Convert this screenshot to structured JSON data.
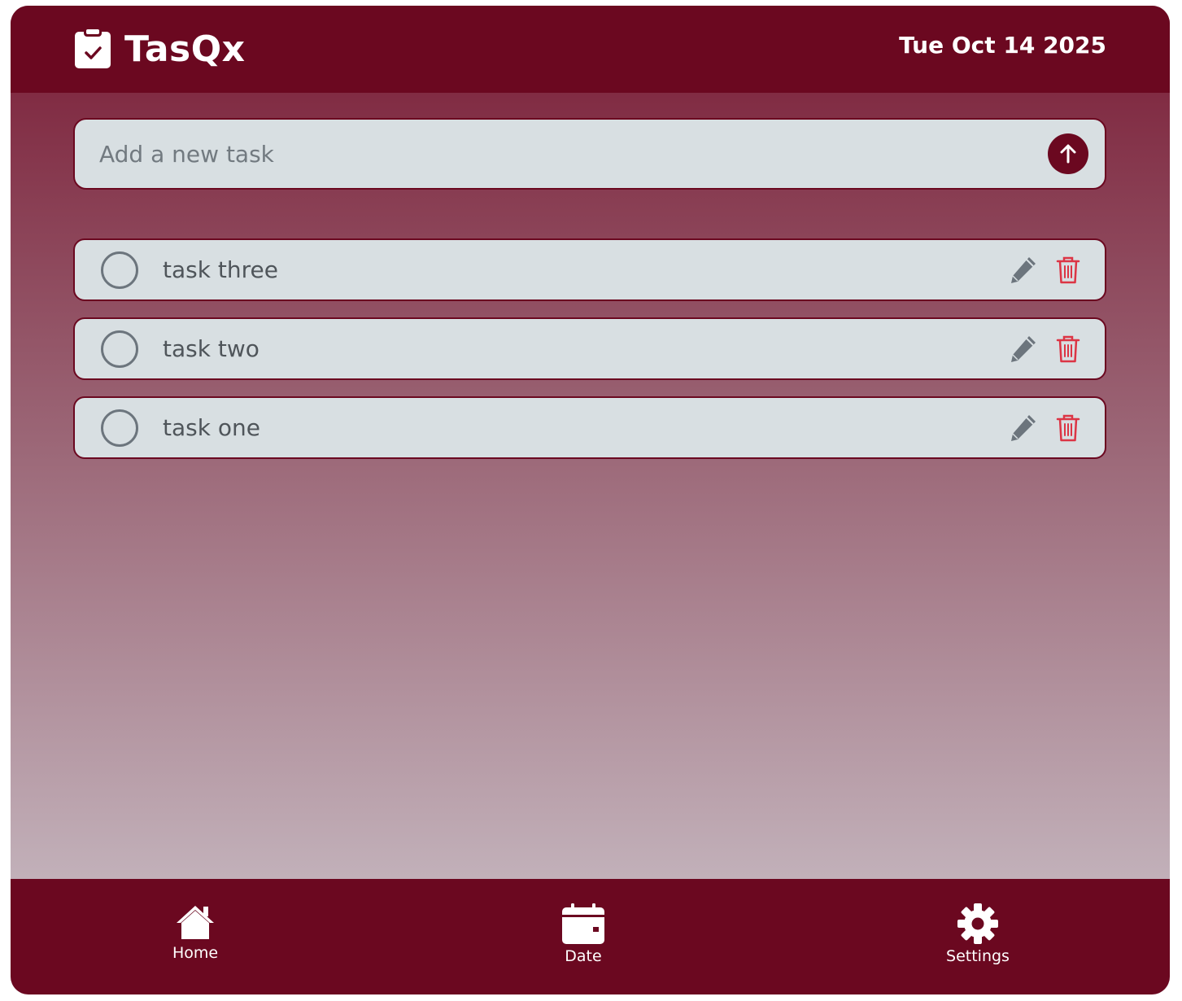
{
  "header": {
    "app_title": "TasQx",
    "date": "Tue Oct 14 2025"
  },
  "add_task": {
    "placeholder": "Add a new task",
    "value": ""
  },
  "tasks": [
    {
      "label": "task three",
      "completed": false
    },
    {
      "label": "task two",
      "completed": false
    },
    {
      "label": "task one",
      "completed": false
    }
  ],
  "bottom_nav": {
    "items": [
      {
        "label": "Home",
        "icon": "home-icon"
      },
      {
        "label": "Date",
        "icon": "calendar-icon"
      },
      {
        "label": "Settings",
        "icon": "gear-icon"
      }
    ]
  },
  "colors": {
    "brand": "#6b0820",
    "card": "#d8dfe2",
    "delete": "#dc3545",
    "edit": "#6c757d"
  }
}
